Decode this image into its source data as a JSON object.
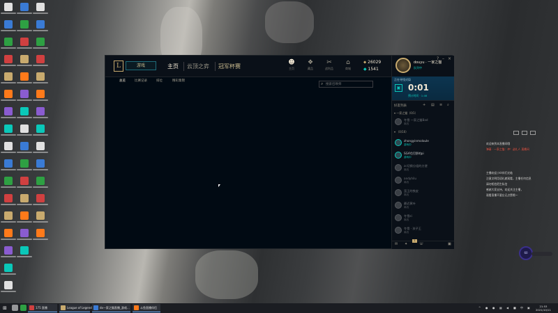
{
  "colors": {
    "gold": "#c8aa6e",
    "teal": "#0ac8b9",
    "client_bg": "#010a13",
    "panel_bg": "#0a1018",
    "taskbar_bg": "#1b1d22",
    "overlay_red": "#ff6a5a"
  },
  "desktop": {
    "icon_names": [
      "desktop-shortcut-icon"
    ]
  },
  "client": {
    "logo": "L",
    "play_label": "游戏",
    "nav": {
      "home": "主页",
      "tft": "云顶之弈",
      "clash": "冠军杯赛"
    },
    "icon_nav": [
      {
        "icon": "profile-icon",
        "glyph": "☻",
        "label": "主页"
      },
      {
        "icon": "collection-icon",
        "glyph": "❖",
        "label": "藏品"
      },
      {
        "icon": "loot-icon",
        "glyph": "✂",
        "label": "战利品"
      },
      {
        "icon": "store-icon",
        "glyph": "⌂",
        "label": "商城"
      }
    ],
    "currency": {
      "rp": "26029",
      "be": "1541"
    },
    "subtabs": [
      "总览",
      "比赛记录",
      "排位",
      "精彩集锦"
    ],
    "search": {
      "placeholder": "搜索召唤师"
    }
  },
  "social": {
    "summoner_name": "douyu · 一家之猫",
    "status": "队列中",
    "queue": {
      "title": "正在寻找对局",
      "timer": "0:01",
      "estimate": "预计时间 · 1:46"
    },
    "friends_header": "好友列表",
    "groups": [
      {
        "label": "一家之猫（0/1）"
      },
      {
        "label": "（0/10）"
      }
    ],
    "friends": [
      {
        "name": "冬雪 一家之猫Bad",
        "status": "离线",
        "online": false
      },
      {
        "name": "zhongyinmoloule",
        "status": "游戏中",
        "online": true
      },
      {
        "name": "SGAYJ打野的pi",
        "status": "游戏中",
        "online": true
      },
      {
        "name": "zc切换分组的方便",
        "status": "离线",
        "online": false
      },
      {
        "name": "andyhilu",
        "status": "离线",
        "online": false
      },
      {
        "name": "蛮王的铁皮",
        "status": "离线",
        "online": false
      },
      {
        "name": "最近黄叶",
        "status": "离线",
        "online": false
      },
      {
        "name": "冬雪zi",
        "status": "离线",
        "online": false
      },
      {
        "name": "冬雪 · 孩子王",
        "status": "离线",
        "online": false
      }
    ],
    "bottom_badge": "1"
  },
  "overlay": {
    "lines_top": [
      {
        "text": "欢迎来到本直播间哦",
        "red": false
      },
      {
        "text": "弹幕 · 一家之猫：冲！送礼人 直播间",
        "red": true
      }
    ],
    "lines_bottom": [
      "主播欢迎小伙伴们光临",
      "注意文明用语礼貌观看，主播任何信息",
      "请勿相信陌生私信",
      "感谢大家支持，欢迎关注主播，",
      "观看直播不要忘记点赞哦～"
    ],
    "ring_label": "60"
  },
  "taskbar": {
    "start_glyph": "⊞",
    "tasks": [
      {
        "label": "175 直播",
        "color": "#d04040"
      },
      {
        "label": "League of Legends",
        "color": "#c8aa6e"
      },
      {
        "label": "dx—家之猫直播_游戏...",
        "color": "#3a7bd5"
      },
      {
        "label": "斗鱼直播伴侣",
        "color": "#ff7a1a"
      }
    ],
    "clock_time": "21:53",
    "clock_date": "2021/10/11"
  }
}
